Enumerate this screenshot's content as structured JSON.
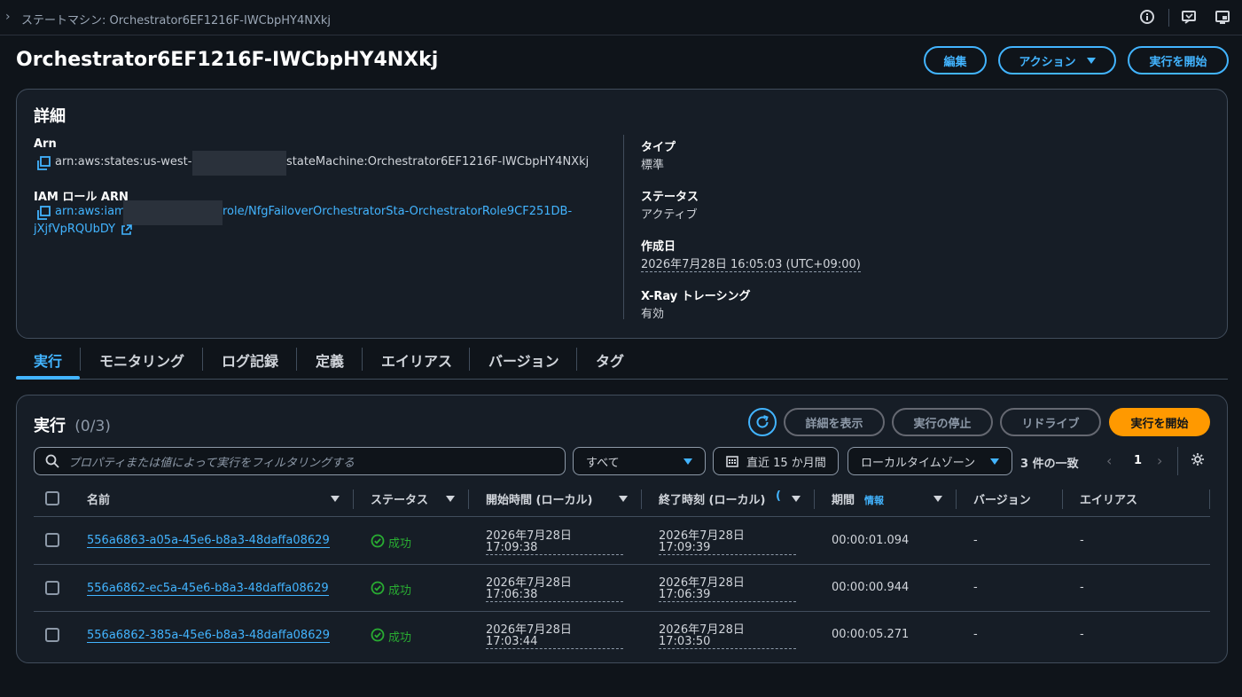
{
  "topbar": {
    "breadcrumb": "ステートマシン: Orchestrator6EF1216F-IWCbpHY4NXkj",
    "icons": [
      "info-icon",
      "feedback-icon",
      "screen-icon"
    ]
  },
  "header": {
    "title": "Orchestrator6EF1216F-IWCbpHY4NXkj",
    "edit_label": "編集",
    "actions_label": "アクション",
    "start_label": "実行を開始"
  },
  "details": {
    "heading": "詳細",
    "arn_label": "Arn",
    "arn_prefix": "arn:aws:states:us-west-2",
    "arn_suffix": "stateMachine:Orchestrator6EF1216F-IWCbpHY4NXkj",
    "iam_label": "IAM ロール ARN",
    "iam_prefix": "arn:aws:iam:",
    "iam_suffix": "role/NfgFailoverOrchestratorSta-OrchestratorRole9CF251DB-",
    "iam_suffix2": "jXjfVpRQUbDY",
    "type_label": "タイプ",
    "type_value": "標準",
    "status_label": "ステータス",
    "status_value": "アクティブ",
    "created_label": "作成日",
    "created_value": "2026年7月28日 16:05:03 (UTC+09:00)",
    "xray_label": "X-Ray トレーシング",
    "xray_value": "有効"
  },
  "tabs": [
    "実行",
    "モニタリング",
    "ログ記録",
    "定義",
    "エイリアス",
    "バージョン",
    "タグ"
  ],
  "executions": {
    "heading": "実行",
    "count": "(0/3)",
    "view_details": "詳細を表示",
    "stop": "実行の停止",
    "redrive": "リドライブ",
    "start": "実行を開始",
    "search_placeholder": "プロパティまたは値によって実行をフィルタリングする",
    "filter_value": "すべて",
    "date_range": "直近 15 か月間",
    "timezone": "ローカルタイムゾーン",
    "match_count": "3 件の一致",
    "page": "1",
    "columns": {
      "name": "名前",
      "status": "ステータス",
      "start": "開始時間 (ローカル)",
      "end": "終了時刻 (ローカル)",
      "duration": "期間",
      "duration_info": "情報",
      "version": "バージョン",
      "alias": "エイリアス"
    },
    "rows": [
      {
        "name": "556a6863-a05a-45e6-b8a3-48daffa08629",
        "status": "成功",
        "start_date": "2026年7月28日",
        "start_time": "17:09:38",
        "end_date": "2026年7月28日",
        "end_time": "17:09:39",
        "duration": "00:00:01.094",
        "version": "-",
        "alias": "-"
      },
      {
        "name": "556a6862-ec5a-45e6-b8a3-48daffa08629",
        "status": "成功",
        "start_date": "2026年7月28日",
        "start_time": "17:06:38",
        "end_date": "2026年7月28日",
        "end_time": "17:06:39",
        "duration": "00:00:00.944",
        "version": "-",
        "alias": "-"
      },
      {
        "name": "556a6862-385a-45e6-b8a3-48daffa08629",
        "status": "成功",
        "start_date": "2026年7月28日",
        "start_time": "17:03:44",
        "end_date": "2026年7月28日",
        "end_time": "17:03:50",
        "duration": "00:00:05.271",
        "version": "-",
        "alias": "-"
      }
    ]
  }
}
